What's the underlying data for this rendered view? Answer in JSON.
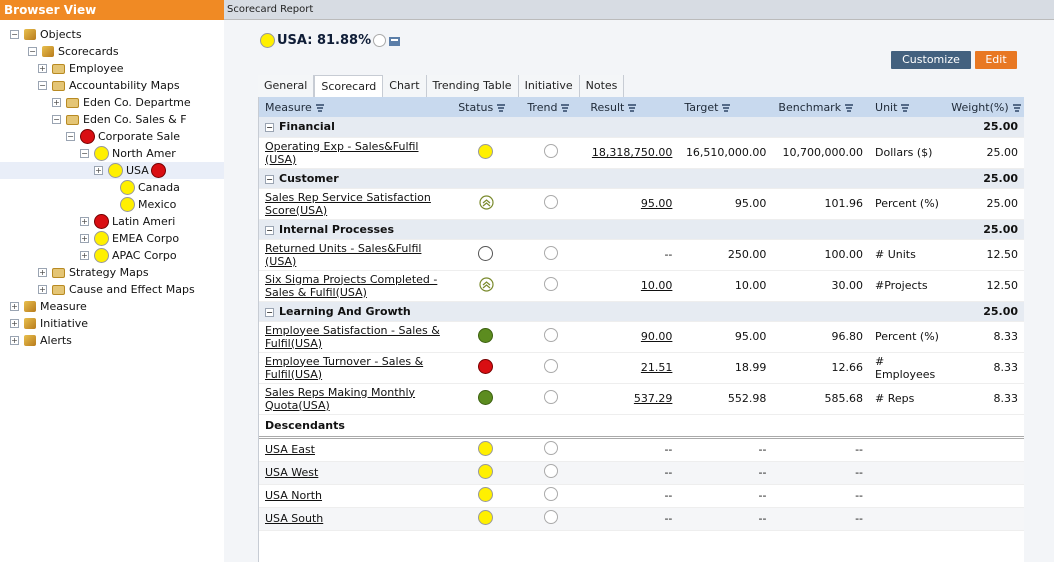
{
  "left": {
    "title": "Browser View",
    "nodes": [
      {
        "label": "Objects",
        "type": "cube",
        "toggle": "-"
      },
      {
        "label": "Scorecards",
        "type": "cube",
        "toggle": "-"
      },
      {
        "label": "Employee",
        "type": "folder",
        "toggle": "+"
      },
      {
        "label": "Accountability Maps",
        "type": "folder",
        "toggle": "-"
      },
      {
        "label": "Eden Co. Departme",
        "type": "folder",
        "toggle": "+"
      },
      {
        "label": "Eden Co. Sales & F",
        "type": "folder",
        "toggle": "-"
      },
      {
        "label": "Corporate Sale",
        "type": "dot-red",
        "toggle": "-"
      },
      {
        "label": "North Amer",
        "type": "dot-yellow",
        "toggle": "-"
      },
      {
        "label": "USA",
        "type": "dot-yellow",
        "toggle": "+"
      },
      {
        "label": "Canada",
        "type": "dot-yellow",
        "toggle": ""
      },
      {
        "label": "Mexico",
        "type": "dot-yellow",
        "toggle": ""
      },
      {
        "label": "Latin Ameri",
        "type": "dot-red",
        "toggle": "+"
      },
      {
        "label": "EMEA Corpo",
        "type": "dot-yellow",
        "toggle": "+"
      },
      {
        "label": "APAC Corpo",
        "type": "dot-yellow",
        "toggle": "+"
      },
      {
        "label": "Strategy Maps",
        "type": "folder",
        "toggle": "+"
      },
      {
        "label": "Cause and Effect Maps",
        "type": "folder",
        "toggle": "+"
      },
      {
        "label": "Measure",
        "type": "cube",
        "toggle": "+"
      },
      {
        "label": "Initiative",
        "type": "cube",
        "toggle": "+"
      },
      {
        "label": "Alerts",
        "type": "cube",
        "toggle": "+"
      }
    ]
  },
  "right": {
    "title": "Scorecard Report",
    "scorecard_title": "USA: 81.88%",
    "buttons": {
      "customize": "Customize",
      "edit": "Edit"
    },
    "tabs": [
      "General",
      "Scorecard",
      "Chart",
      "Trending Table",
      "Initiative",
      "Notes"
    ],
    "columns": [
      "Measure",
      "Status",
      "Trend",
      "Result",
      "Target",
      "Benchmark",
      "Unit",
      "Weight(%)"
    ],
    "sections": [
      {
        "name": "Financial",
        "weight": "25.00",
        "rows": [
          {
            "measure": "Operating Exp - Sales&Fulfil (USA)",
            "status": "yellow",
            "trend": "empty",
            "result": "18,318,750.00",
            "target": "16,510,000.00",
            "benchmark": "10,700,000.00",
            "unit": "Dollars ($)",
            "weight": "25.00"
          }
        ]
      },
      {
        "name": "Customer",
        "weight": "25.00",
        "rows": [
          {
            "measure": "Sales Rep Service Satisfaction Score(USA)",
            "status": "up",
            "trend": "empty",
            "result": "95.00",
            "target": "95.00",
            "benchmark": "101.96",
            "unit": "Percent (%)",
            "weight": "25.00"
          }
        ]
      },
      {
        "name": "Internal Processes",
        "weight": "25.00",
        "rows": [
          {
            "measure": "Returned Units - Sales&Fulfil (USA)",
            "status": "white",
            "trend": "empty",
            "result": "--",
            "target": "250.00",
            "benchmark": "100.00",
            "unit": "# Units",
            "weight": "12.50"
          },
          {
            "measure": "Six Sigma Projects Completed -Sales & Fulfil(USA)",
            "status": "up",
            "trend": "empty",
            "result": "10.00",
            "target": "10.00",
            "benchmark": "30.00",
            "unit": "#Projects",
            "weight": "12.50"
          }
        ]
      },
      {
        "name": "Learning And Growth",
        "weight": "25.00",
        "rows": [
          {
            "measure": "Employee Satisfaction - Sales & Fulfil(USA)",
            "status": "green",
            "trend": "empty",
            "result": "90.00",
            "target": "95.00",
            "benchmark": "96.80",
            "unit": "Percent (%)",
            "weight": "8.33"
          },
          {
            "measure": "Employee Turnover - Sales & Fulfil(USA)",
            "status": "red",
            "trend": "empty",
            "result": "21.51",
            "target": "18.99",
            "benchmark": "12.66",
            "unit": "# Employees",
            "weight": "8.33"
          },
          {
            "measure": "Sales Reps Making Monthly Quota(USA)",
            "status": "green",
            "trend": "empty",
            "result": "537.29",
            "target": "552.98",
            "benchmark": "585.68",
            "unit": "# Reps",
            "weight": "8.33"
          }
        ]
      }
    ],
    "descendants_label": "Descendants",
    "descendants": [
      {
        "name": "USA East",
        "status": "yellow",
        "trend": "empty",
        "result": "--",
        "target": "--",
        "benchmark": "--"
      },
      {
        "name": "USA West",
        "status": "yellow",
        "trend": "empty",
        "result": "--",
        "target": "--",
        "benchmark": "--"
      },
      {
        "name": "USA North",
        "status": "yellow",
        "trend": "empty",
        "result": "--",
        "target": "--",
        "benchmark": "--"
      },
      {
        "name": "USA South",
        "status": "yellow",
        "trend": "empty",
        "result": "--",
        "target": "--",
        "benchmark": "--"
      }
    ]
  }
}
